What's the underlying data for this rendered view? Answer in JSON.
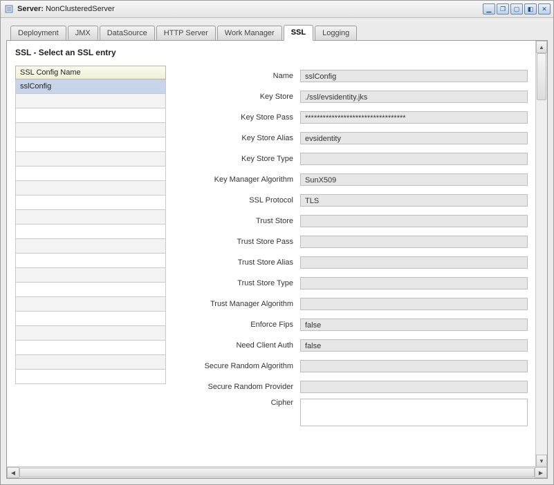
{
  "window": {
    "title_prefix": "Server:",
    "title_value": "NonClusteredServer"
  },
  "tabs": [
    {
      "label": "Deployment",
      "active": false
    },
    {
      "label": "JMX",
      "active": false
    },
    {
      "label": "DataSource",
      "active": false
    },
    {
      "label": "HTTP Server",
      "active": false
    },
    {
      "label": "Work Manager",
      "active": false
    },
    {
      "label": "SSL",
      "active": true
    },
    {
      "label": "Logging",
      "active": false
    }
  ],
  "panel": {
    "subtitle": "SSL - Select an SSL entry"
  },
  "list": {
    "header": "SSL Config Name",
    "rows": [
      "sslConfig",
      "",
      "",
      "",
      "",
      "",
      "",
      "",
      "",
      "",
      "",
      "",
      "",
      "",
      "",
      "",
      "",
      "",
      "",
      "",
      ""
    ]
  },
  "form": {
    "fields": [
      {
        "label": "Name",
        "value": "sslConfig"
      },
      {
        "label": "Key Store",
        "value": "./ssl/evsidentity.jks"
      },
      {
        "label": "Key Store Pass",
        "value": "**********************************"
      },
      {
        "label": "Key Store Alias",
        "value": "evsidentity"
      },
      {
        "label": "Key Store Type",
        "value": ""
      },
      {
        "label": "Key Manager Algorithm",
        "value": "SunX509"
      },
      {
        "label": "SSL Protocol",
        "value": "TLS"
      },
      {
        "label": "Trust Store",
        "value": ""
      },
      {
        "label": "Trust Store Pass",
        "value": ""
      },
      {
        "label": "Trust Store Alias",
        "value": ""
      },
      {
        "label": "Trust Store Type",
        "value": ""
      },
      {
        "label": "Trust Manager Algorithm",
        "value": ""
      },
      {
        "label": "Enforce Fips",
        "value": "false"
      },
      {
        "label": "Need Client Auth",
        "value": "false"
      },
      {
        "label": "Secure Random Algorithm",
        "value": ""
      },
      {
        "label": "Secure Random Provider",
        "value": ""
      },
      {
        "label": "Cipher",
        "value": "",
        "multiline": true
      }
    ]
  }
}
